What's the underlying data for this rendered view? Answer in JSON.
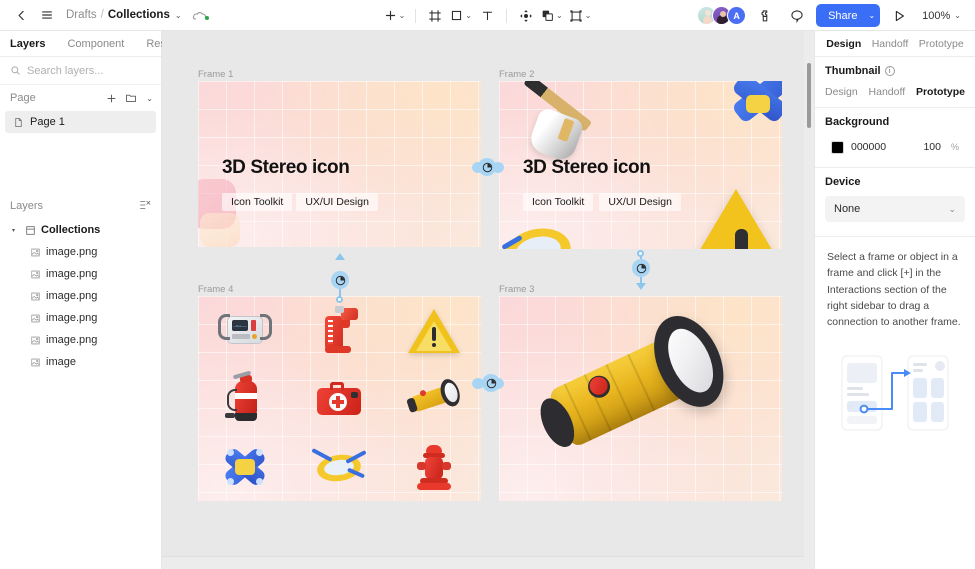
{
  "topbar": {
    "back_icon": "chevron-left-icon",
    "menu_icon": "hamburger-menu-icon",
    "breadcrumb": {
      "parent": "Drafts",
      "separator": "/",
      "current": "Collections",
      "caret": "⌄"
    },
    "cloud_icon": "cloud-saved-icon",
    "tools": [
      {
        "name": "add-tool",
        "glyph": "+",
        "has_caret": true
      },
      {
        "name": "frame-tool",
        "glyph": "frame",
        "has_caret": false
      },
      {
        "name": "shape-tool",
        "glyph": "square",
        "has_caret": true
      },
      {
        "name": "text-tool",
        "glyph": "T",
        "has_caret": false
      },
      {
        "name": "move-tool",
        "glyph": "move",
        "has_caret": false
      },
      {
        "name": "component-tool",
        "glyph": "component",
        "has_caret": true
      },
      {
        "name": "slice-tool",
        "glyph": "slice",
        "has_caret": true
      }
    ],
    "avatars": [
      {
        "name": "collaborator-1",
        "initial": ""
      },
      {
        "name": "collaborator-2",
        "initial": ""
      },
      {
        "name": "collaborator-3",
        "initial": "A"
      }
    ],
    "plugin_icon": "plugin-icon",
    "comment_icon": "comment-icon",
    "share_label": "Share",
    "share_caret": "⌄",
    "present_icon": "play-present-icon",
    "zoom_label": "100%",
    "zoom_caret": "⌄",
    "accent_color": "#3b6ef6"
  },
  "left_panel": {
    "tabs": [
      {
        "label": "Layers",
        "active": true
      },
      {
        "label": "Component",
        "active": false
      },
      {
        "label": "Resource",
        "active": false
      }
    ],
    "search": {
      "placeholder": "Search layers...",
      "value": "",
      "icon": "search-icon"
    },
    "page_section": {
      "title": "Page",
      "add_icon": "plus-icon",
      "folder_icon": "folder-icon",
      "collapse_icon": "chevron-down-icon",
      "pages": [
        {
          "label": "Page 1",
          "icon": "page-icon",
          "selected": true
        }
      ]
    },
    "layers_section": {
      "title": "Layers",
      "options_icon": "layer-options-icon",
      "items": [
        {
          "label": "Collections",
          "icon": "frame-icon",
          "depth": 0,
          "expanded": true
        },
        {
          "label": "image.png",
          "icon": "image-icon",
          "depth": 1
        },
        {
          "label": "image.png",
          "icon": "image-icon",
          "depth": 1
        },
        {
          "label": "image.png",
          "icon": "image-icon",
          "depth": 1
        },
        {
          "label": "image.png",
          "icon": "image-icon",
          "depth": 1
        },
        {
          "label": "image.png",
          "icon": "image-icon",
          "depth": 1
        },
        {
          "label": "image",
          "icon": "image-icon",
          "depth": 1
        }
      ]
    }
  },
  "canvas": {
    "background_color": "#e8e8e8",
    "frames": [
      {
        "name": "Frame 1",
        "title": "3D Stereo icon",
        "tags": [
          "Icon Toolkit",
          "UX/UI Design"
        ]
      },
      {
        "name": "Frame 2",
        "title": "3D Stereo icon",
        "tags": [
          "Icon Toolkit",
          "UX/UI Design"
        ]
      },
      {
        "name": "Frame 4",
        "title": "",
        "tags": []
      },
      {
        "name": "Frame 3",
        "title": "",
        "tags": []
      }
    ],
    "icon_grid": [
      "defibrillator",
      "blow-torch",
      "warning-triangle",
      "fire-extinguisher",
      "first-aid-kit",
      "flashlight",
      "bandages",
      "life-raft",
      "fire-hydrant"
    ],
    "prototype_pins": [
      {
        "name": "prototype-pin-frame1-right",
        "type": "timer"
      },
      {
        "name": "prototype-pin-frame2-left",
        "type": "timer"
      },
      {
        "name": "prototype-pin-frame4-up",
        "type": "timer"
      },
      {
        "name": "prototype-pin-frame2-down",
        "type": "timer"
      },
      {
        "name": "prototype-pin-frame3-left",
        "type": "timer"
      }
    ],
    "connector_color": "#8cc6ee"
  },
  "right_panel": {
    "tabs": [
      {
        "label": "Design",
        "active": true
      },
      {
        "label": "Handoff",
        "active": false
      },
      {
        "label": "Prototype",
        "active": false
      }
    ],
    "thumbnail": {
      "title": "Thumbnail",
      "info_icon": "info-icon"
    },
    "sub_tabs": [
      {
        "label": "Design",
        "active": false
      },
      {
        "label": "Handoff",
        "active": false
      },
      {
        "label": "Prototype",
        "active": true
      }
    ],
    "background": {
      "title": "Background",
      "color_hex": "000000",
      "color_value": "#000000",
      "opacity": "100",
      "opacity_symbol": "%"
    },
    "device": {
      "title": "Device",
      "selected": "None",
      "caret": "⌄"
    },
    "hint": "Select a frame or object in a frame and click [+] in the Interactions section of the right sidebar to drag a connection to another frame.",
    "illustration_name": "prototype-connection-illustration"
  }
}
